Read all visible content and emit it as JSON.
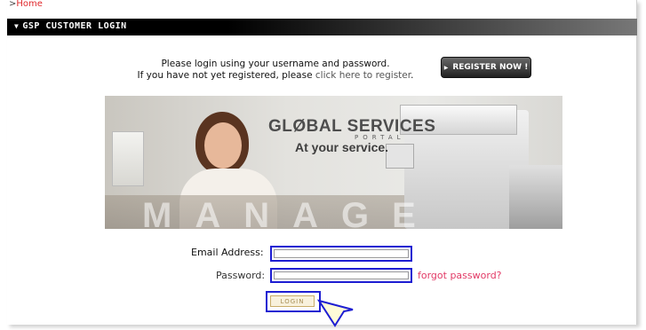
{
  "breadcrumb": {
    "prefix": ">",
    "home": "Home"
  },
  "section": {
    "title": "GSP CUSTOMER LOGIN"
  },
  "intro": {
    "line1": "Please login using your username and password.",
    "line2_prefix": "If you have not yet registered, please",
    "line2_link": "click here to register",
    "line2_suffix": "."
  },
  "register_button": {
    "label": "REGISTER NOW !"
  },
  "banner": {
    "logo": "GLØBAL SERVICES",
    "logo_sub": "PORTAL",
    "tagline": "At your service.",
    "watermark": "MANAGE"
  },
  "form": {
    "email_label": "Email Address:",
    "email_value": "",
    "password_label": "Password:",
    "password_value": "",
    "forgot_link": "forgot password?",
    "login_label": "LOGIN"
  },
  "colors": {
    "highlight_border": "#1e1ed2",
    "link_red": "#e23a66",
    "breadcrumb_red": "#e0282c"
  }
}
